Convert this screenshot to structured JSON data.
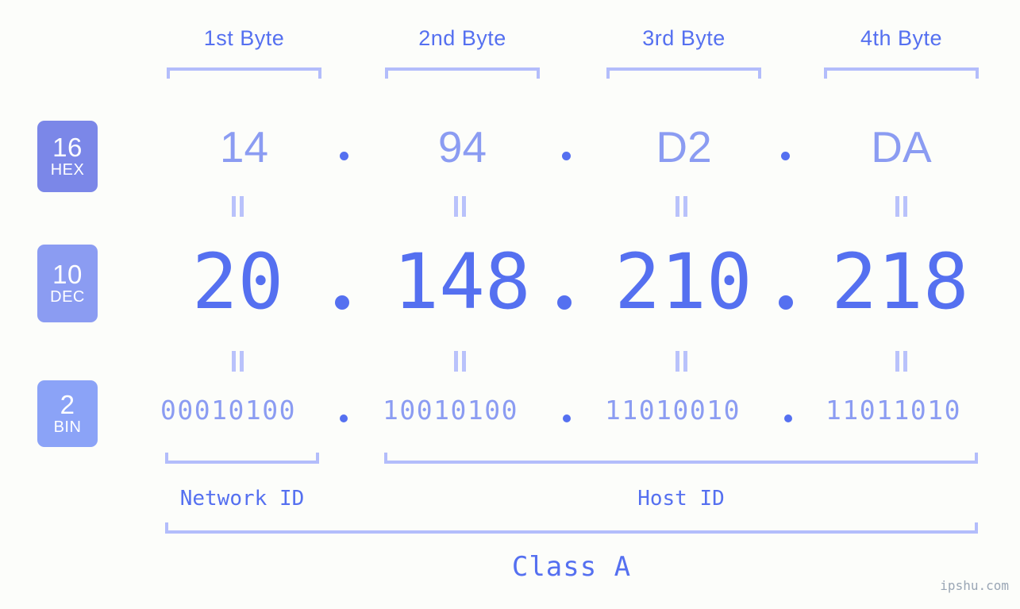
{
  "watermark": "ipshu.com",
  "byte_headers": [
    {
      "label": "1st Byte"
    },
    {
      "label": "2nd Byte"
    },
    {
      "label": "3rd Byte"
    },
    {
      "label": "4th Byte"
    }
  ],
  "bases": {
    "hex": {
      "radix": "16",
      "name": "HEX",
      "color": "#7b87e8"
    },
    "dec": {
      "radix": "10",
      "name": "DEC",
      "color": "#8b9cf2"
    },
    "bin": {
      "radix": "2",
      "name": "BIN",
      "color": "#8ba3f7"
    }
  },
  "rows": {
    "hex": {
      "values": [
        "14",
        "94",
        "D2",
        "DA"
      ],
      "separator": "."
    },
    "dec": {
      "values": [
        "20",
        "148",
        "210",
        "218"
      ],
      "separator": "."
    },
    "bin": {
      "values": [
        "00010100",
        "10010100",
        "11010010",
        "11011010"
      ],
      "separator": "."
    }
  },
  "ip": {
    "hex_address": "14.94.D2.DA",
    "dec_address": "20.148.210.218",
    "bin_address": "00010100.10010100.11010010.11011010"
  },
  "segments": {
    "network_id": "Network ID",
    "host_id": "Host ID",
    "class": "Class A"
  },
  "colors": {
    "background": "#fcfdfa",
    "primary_blue": "#5570f0",
    "light_blue": "#8b9cf2",
    "bracket": "#b3bdfb",
    "equals": "#b9c2fb"
  }
}
